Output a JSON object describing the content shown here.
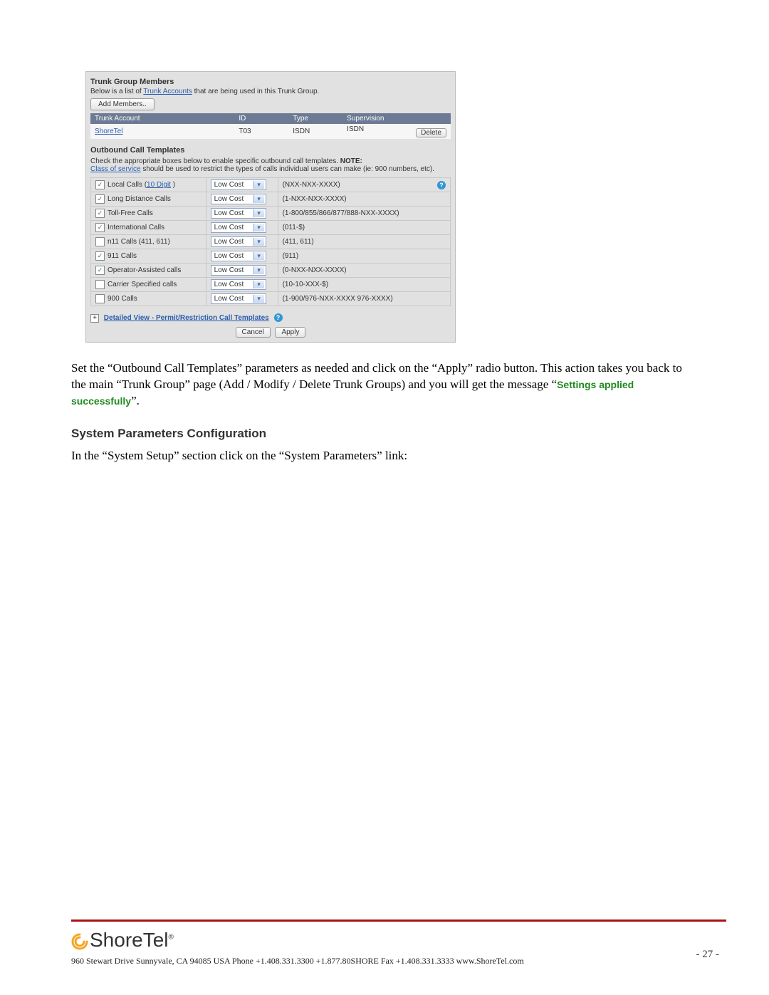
{
  "trunk_group": {
    "title": "Trunk Group Members",
    "subtitle_prefix": "Below is a list of ",
    "subtitle_link": "Trunk Accounts",
    "subtitle_suffix": " that are being used in this Trunk Group.",
    "add_btn": "Add Members..",
    "headers": [
      "Trunk Account",
      "ID",
      "Type",
      "Supervision"
    ],
    "row": {
      "account": "ShoreTel",
      "id": "T03",
      "type": "ISDN",
      "supervision": "ISDN",
      "delete_btn": "Delete"
    }
  },
  "outbound": {
    "title": "Outbound Call Templates",
    "note_pre": "Check the appropriate boxes below to enable specific outbound call templates. ",
    "note_bold": "NOTE:",
    "note_link": "Class of service",
    "note_post": " should be used to restrict the types of calls individual users can make (ie: 900 numbers, etc).",
    "rows": [
      {
        "checked": true,
        "label_pre": "Local Calls (",
        "label_link": "10 Digit",
        "label_post": " )",
        "cost": "Low Cost",
        "pattern": "(NXX-NXX-XXXX)",
        "help": true
      },
      {
        "checked": true,
        "label": "Long Distance Calls",
        "cost": "Low Cost",
        "pattern": "(1-NXX-NXX-XXXX)"
      },
      {
        "checked": true,
        "label": "Toll-Free Calls",
        "cost": "Low Cost",
        "pattern": "(1-800/855/866/877/888-NXX-XXXX)"
      },
      {
        "checked": true,
        "label": "International Calls",
        "cost": "Low Cost",
        "pattern": "(011-$)"
      },
      {
        "checked": false,
        "label": "n11 Calls (411, 611)",
        "cost": "Low Cost",
        "pattern": "(411, 611)"
      },
      {
        "checked": true,
        "label": "911 Calls",
        "cost": "Low Cost",
        "pattern": "(911)"
      },
      {
        "checked": true,
        "label": "Operator-Assisted calls",
        "cost": "Low Cost",
        "pattern": "(0-NXX-NXX-XXXX)"
      },
      {
        "checked": false,
        "label": "Carrier Specified calls",
        "cost": "Low Cost",
        "pattern": "(10-10-XXX-$)"
      },
      {
        "checked": false,
        "label": "900 Calls",
        "cost": "Low Cost",
        "pattern": "(1-900/976-NXX-XXXX 976-XXXX)"
      }
    ],
    "detailed": "Detailed View - Permit/Restriction Call Templates",
    "cancel": "Cancel",
    "apply": "Apply"
  },
  "doc": {
    "para1": "Set the “Outbound Call Templates” parameters as needed and click on the “Apply” radio button.  This action takes you back to the main “Trunk Group” page (Add / Modify / Delete Trunk Groups) and you will get the message “",
    "success": "Settings applied successfully",
    "para1_end": "”.",
    "section": "System Parameters Configuration",
    "para2": "In the “System Setup” section click on the “System Parameters” link:"
  },
  "footer": {
    "logo": "ShoreTel",
    "address": "960 Stewart Drive  Sunnyvale, CA 94085 USA  Phone +1.408.331.3300 +1.877.80SHORE Fax +1.408.331.3333 www.ShoreTel.com",
    "page": "- 27 -"
  }
}
